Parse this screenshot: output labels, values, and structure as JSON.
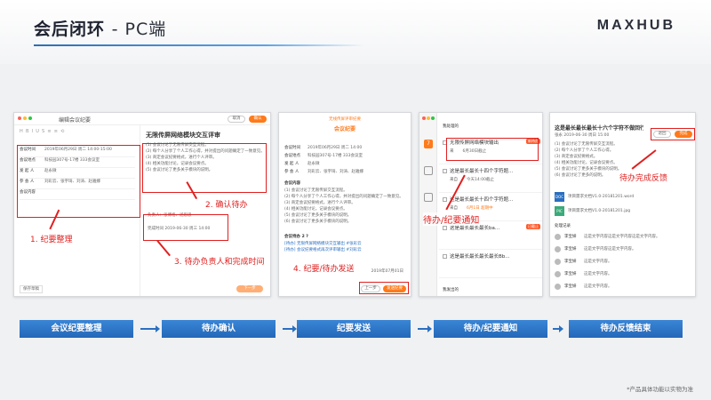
{
  "header": {
    "title": "会后闭环",
    "subtitle": "- PC端",
    "brand": "MAXHUB"
  },
  "screen1": {
    "window_title": "编辑会议纪要",
    "top_buttons": [
      "取消",
      "确认"
    ],
    "form": [
      {
        "label": "会议时间",
        "value": "2019年06月29日 周二 14:00-15:00"
      },
      {
        "label": "会议地点",
        "value": "科技园307号-17楼 333会议室"
      },
      {
        "label": "发 起 人",
        "value": "赵永微"
      },
      {
        "label": "参 会 人",
        "value": "刘彩云、张宇琦、刘涛、赵雅娜"
      },
      {
        "label": "会议内容",
        "value": ""
      }
    ],
    "doc_title": "无限传屏网络模块交互评审",
    "doc_lines": [
      "(1) 会议讨论了无限传屏交互流程。",
      "(2) 每个人分享了个人工作心得，并对提出的问题确定了一致意见。",
      "(3) 商定会议纪要格式，进行个人评审。",
      "(4) 相关功能讨论，记录会议要点。",
      "(5) 会议讨论了更多关于模块的说明。"
    ],
    "todo_label": "负责人：张博格、涵思思",
    "todo_time": "完成时间 2019-06-30 周三 14:00",
    "bottom_left": "保存草稿",
    "bottom_right": "下一步",
    "ann1": "1. 纪要整理",
    "ann2": "2. 确认待办",
    "ann3": "3. 待办负责人和完成时间"
  },
  "screen2": {
    "window_title_small": "无线传屏评审纪要",
    "window_title": "会议纪要",
    "info": [
      {
        "label": "会议时间",
        "value": "2019年06月29日 周二 14:00"
      },
      {
        "label": "会议地点",
        "value": "科技园307号-17楼 333会议室"
      },
      {
        "label": "发 起 人",
        "value": "赵永微"
      },
      {
        "label": "参 会 人",
        "value": "刘彩云、张宇琦、刘涛、赵雅娜"
      }
    ],
    "section": "会议内容",
    "lines": [
      "(1) 会议讨论了无限传屏交互流程。",
      "(2) 每个人分享了个人工作心得，并对提出的问题确定了一致意见。",
      "(3) 商定会议纪要格式，进行个人评审。",
      "(4) 相关功能讨论，记录会议要点。",
      "(5) 会议讨论了更多关于模块的说明。",
      "(6) 会议讨论了更多关于模块的说明。"
    ],
    "todo_title": "会议待办 2 ?",
    "todo_1": "[待办] 无限传屏网络模块交互输出 #张彩云",
    "todo_2": "[待办] 会议纪要格式再次评审输出 #刘彩云",
    "date": "2019年07月01日",
    "btn_prev": "上一步",
    "btn_send": "发送纪要",
    "ann4": "4. 纪要/待办发送"
  },
  "screen3": {
    "header": "我处理的",
    "items": [
      {
        "title": "无限传屏网络模块输出",
        "badge": "新待办",
        "meta1": "来",
        "meta2": "6月30日截止"
      },
      {
        "title": "这是最长最长十四个字符题...",
        "badge": "",
        "meta1": "来自",
        "meta2": "今天14:00截止"
      },
      {
        "title": "这是最长最长十四个字符题...",
        "badge": "",
        "meta1": "来自",
        "meta2": "6月1日 超期中"
      },
      {
        "title": "这是最长最长最长ba...",
        "badge": "已截止",
        "meta1": "",
        "meta2": ""
      },
      {
        "title": "这是最长最长最长最长Bb...",
        "badge": "",
        "meta1": "",
        "meta2": ""
      }
    ],
    "footer": "我发出的",
    "ann5": "待办/纪要通知"
  },
  "screen4": {
    "title": "这是最长最长最长十六个字符不做回行",
    "meta": "张永  2019-06-30 周日 15:00",
    "btn_left": "退回",
    "btn_right": "完成",
    "lines": [
      "(1) 会议讨论了无限传屏交互流程。",
      "(2) 每个人分享了个人工作心得。",
      "(3) 商定会议纪要格式。",
      "(4) 相关功能讨论，记录会议要点。",
      "(5) 会议讨论了更多关于模块的说明。",
      "(6) 会议讨论了更多的说明。"
    ],
    "files": [
      {
        "icon": "DOC",
        "name": "项目需求文档V1.0-20181201.word"
      },
      {
        "icon": "PIC",
        "name": "项目需求文档V1.0-20181201.jpg"
      }
    ],
    "log_title": "处理记录",
    "logs": [
      {
        "name": "李宝妍",
        "text": "这是文字内容这是文字内容这是文字内容。"
      },
      {
        "name": "李宝妍",
        "text": "这是文字内容这是文字内容。"
      },
      {
        "name": "李宝妍",
        "text": "这是文字内容。"
      },
      {
        "name": "李宝妍",
        "text": "这是文字内容。"
      },
      {
        "name": "李宝妍",
        "text": "这是文字内容。"
      }
    ],
    "ann6": "待办完成反馈"
  },
  "flow": [
    "会议纪要整理",
    "待办确认",
    "纪要发送",
    "待办/纪要通知",
    "待办反馈结束"
  ],
  "footnote": "*产品具体功能以实物为准",
  "colors": {
    "accent": "#ff7a1a",
    "annotation": "#e02020",
    "flow": "#2a6fc0"
  }
}
